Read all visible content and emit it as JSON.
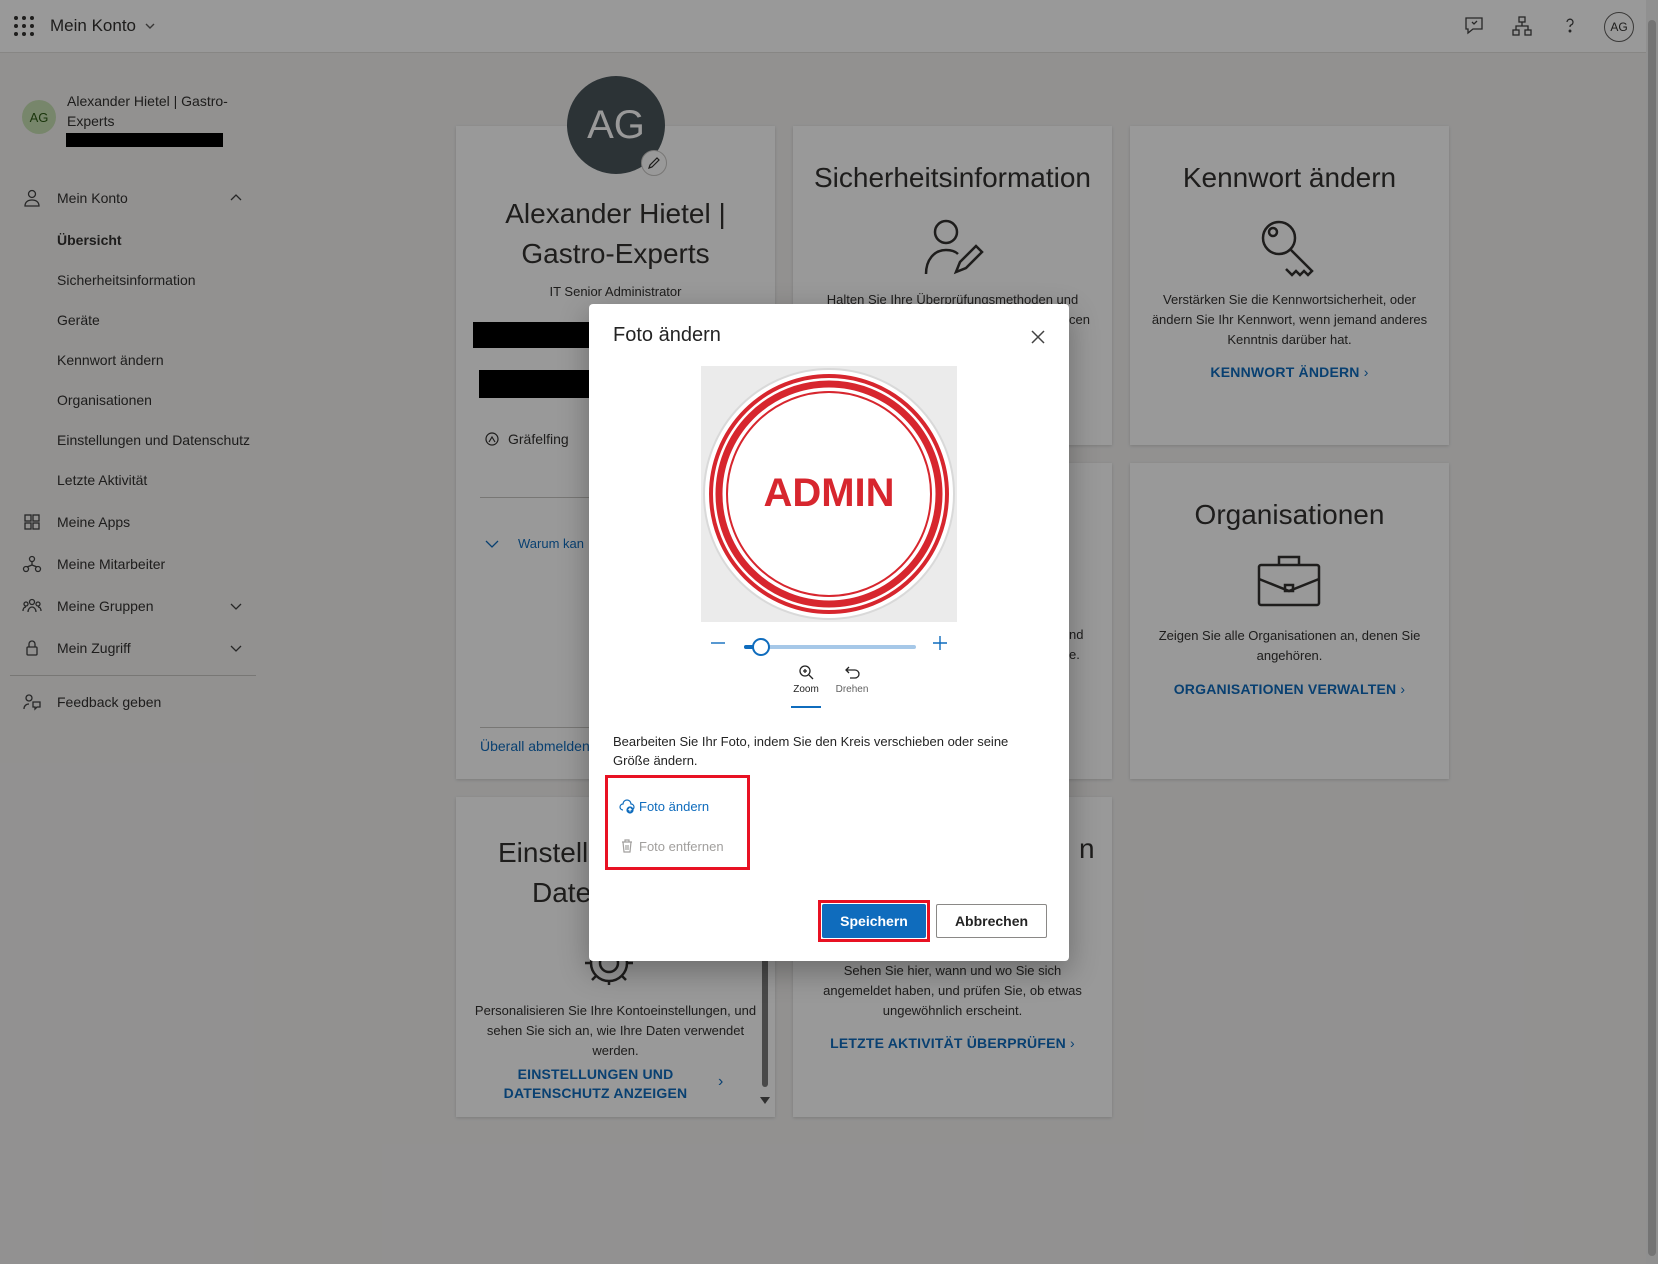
{
  "topbar": {
    "app_title": "Mein Konto",
    "avatar_initials": "AG"
  },
  "sidebar": {
    "user_initials": "AG",
    "user_name": "Alexander Hietel | Gastro-Experts",
    "items": [
      {
        "label": "Mein Konto",
        "icon": "person-icon",
        "expanded": true
      },
      {
        "label": "Übersicht",
        "active": true
      },
      {
        "label": "Sicherheitsinformation"
      },
      {
        "label": "Geräte"
      },
      {
        "label": "Kennwort ändern"
      },
      {
        "label": "Organisationen"
      },
      {
        "label": "Einstellungen und Datenschutz"
      },
      {
        "label": "Letzte Aktivität"
      },
      {
        "label": "Meine Apps",
        "icon": "apps-icon"
      },
      {
        "label": "Meine Mitarbeiter",
        "icon": "org-chart-icon"
      },
      {
        "label": "Meine Gruppen",
        "icon": "people-team-icon"
      },
      {
        "label": "Mein Zugriff",
        "icon": "lock-icon"
      },
      {
        "label": "Feedback geben",
        "icon": "feedback-icon"
      }
    ]
  },
  "profile_card": {
    "initials": "AG",
    "name_line1": "Alexander Hietel |",
    "name_line2": "Gastro-Experts",
    "job_title": "IT Senior Administrator",
    "location": "Gräfelfing",
    "why_link": "Warum kan",
    "sign_out": "Überall abmelden"
  },
  "cards": {
    "security": {
      "title": "Sicherheitsinformation",
      "desc_line1": "Halten Sie Ihre Überprüfungsmethoden und",
      "desc_tail": "cen"
    },
    "password": {
      "title": "Kennwort ändern",
      "desc": "Verstärken Sie die Kennwortsicherheit, oder ändern Sie Ihr Kennwort, wenn jemand anderes Kenntnis darüber hat.",
      "link": "KENNWORT ÄNDERN"
    },
    "devices_partial": {
      "frag1": "nd",
      "frag2": "e."
    },
    "organizations": {
      "title": "Organisationen",
      "desc": "Zeigen Sie alle Organisationen an, denen Sie angehören.",
      "link": "ORGANISATIONEN VERWALTEN"
    },
    "settings": {
      "title_line1": "Einstellu",
      "title_line2": "Date",
      "desc": "Personalisieren Sie Ihre Kontoeinstellungen, und sehen Sie sich an, wie Ihre Daten verwendet werden.",
      "link_line1": "EINSTELLUNGEN UND",
      "link_line2": "DATENSCHUTZ ANZEIGEN"
    },
    "activity": {
      "title_tail": "n",
      "desc": "Sehen Sie hier, wann und wo Sie sich angemeldet haben, und prüfen Sie, ob etwas ungewöhnlich erscheint.",
      "link": "LETZTE AKTIVITÄT ÜBERPRÜFEN"
    }
  },
  "modal": {
    "title": "Foto ändern",
    "photo_text": "ADMIN",
    "zoom_level": 0.1,
    "tool_zoom": "Zoom",
    "tool_rotate": "Drehen",
    "help_text": "Bearbeiten Sie Ihr Foto, indem Sie den Kreis verschieben oder seine Größe ändern.",
    "change_photo": "Foto ändern",
    "remove_photo": "Foto entfernen",
    "save": "Speichern",
    "cancel": "Abbrechen"
  },
  "colors": {
    "accent": "#0f6cbd",
    "highlight": "#e81123",
    "stamp_red": "#d7262e"
  }
}
